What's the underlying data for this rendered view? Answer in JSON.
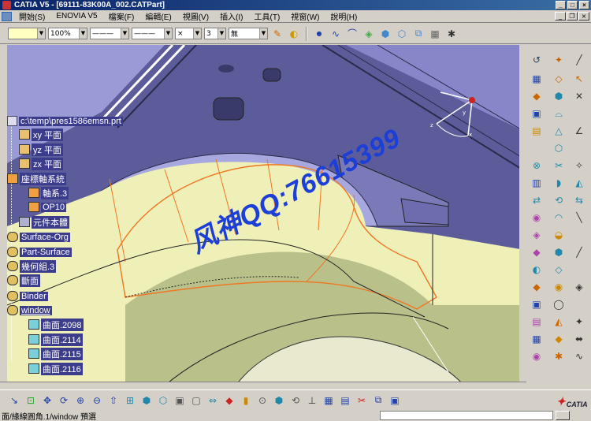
{
  "window": {
    "title": "CATIA V5 - [69111-83K00A_002.CATPart]"
  },
  "menubar": {
    "items": [
      "開始(S)",
      "ENOVIA V5",
      "檔案(F)",
      "編輯(E)",
      "視圖(V)",
      "插入(I)",
      "工具(T)",
      "視窗(W)",
      "說明(H)"
    ]
  },
  "toolbar": {
    "color_value": "",
    "opacity_value": "100%",
    "linetype_value": "———",
    "linestyle_value": "———",
    "point_value": "×",
    "thickness_value": "3",
    "layer_value": "無"
  },
  "spec_tree": {
    "root": "c:\\temp\\pres1586emsn.prt",
    "nodes": [
      {
        "label": "xy 平面",
        "icon": "plane-icon"
      },
      {
        "label": "yz 平面",
        "icon": "plane-icon"
      },
      {
        "label": "zx 平面",
        "icon": "plane-icon"
      },
      {
        "label": "座標軸系統",
        "icon": "axis-system-icon"
      },
      {
        "label": "軸系.3",
        "icon": "axis-icon"
      },
      {
        "label": "OP10",
        "icon": "axis-icon"
      },
      {
        "label": "元件本體",
        "icon": "part-body-icon"
      },
      {
        "label": "Surface-Org",
        "icon": "geometrical-set-icon"
      },
      {
        "label": "Part-Surface",
        "icon": "geometrical-set-icon"
      },
      {
        "label": "幾何組.3",
        "icon": "geometrical-set-icon"
      },
      {
        "label": "斷面",
        "icon": "geometrical-set-icon"
      },
      {
        "label": "Binder",
        "icon": "geometrical-set-icon"
      },
      {
        "label": "window",
        "icon": "geometrical-set-icon"
      },
      {
        "label": "曲面.2098",
        "icon": "surface-icon"
      },
      {
        "label": "曲面.2114",
        "icon": "surface-icon"
      },
      {
        "label": "曲面.2115",
        "icon": "surface-icon"
      },
      {
        "label": "曲面.2116",
        "icon": "surface-icon"
      }
    ]
  },
  "watermark": "风神QQ:76615399",
  "compass": {
    "x_label": "x",
    "y_label": "y",
    "z_label": "z"
  },
  "statusbar": {
    "message": "面/緣線圓角.1/window 預選",
    "command_input": ""
  },
  "brand": {
    "logo_text": "CATIA"
  },
  "colors": {
    "viewport_bg": "#5c5c9a",
    "surface_yellow": "#efefb8",
    "surface_green": "#b9c08a",
    "fillet_orange": "#ee7722",
    "selection_blue": "#3c3c8c",
    "watermark_blue": "#1c3fd8"
  }
}
